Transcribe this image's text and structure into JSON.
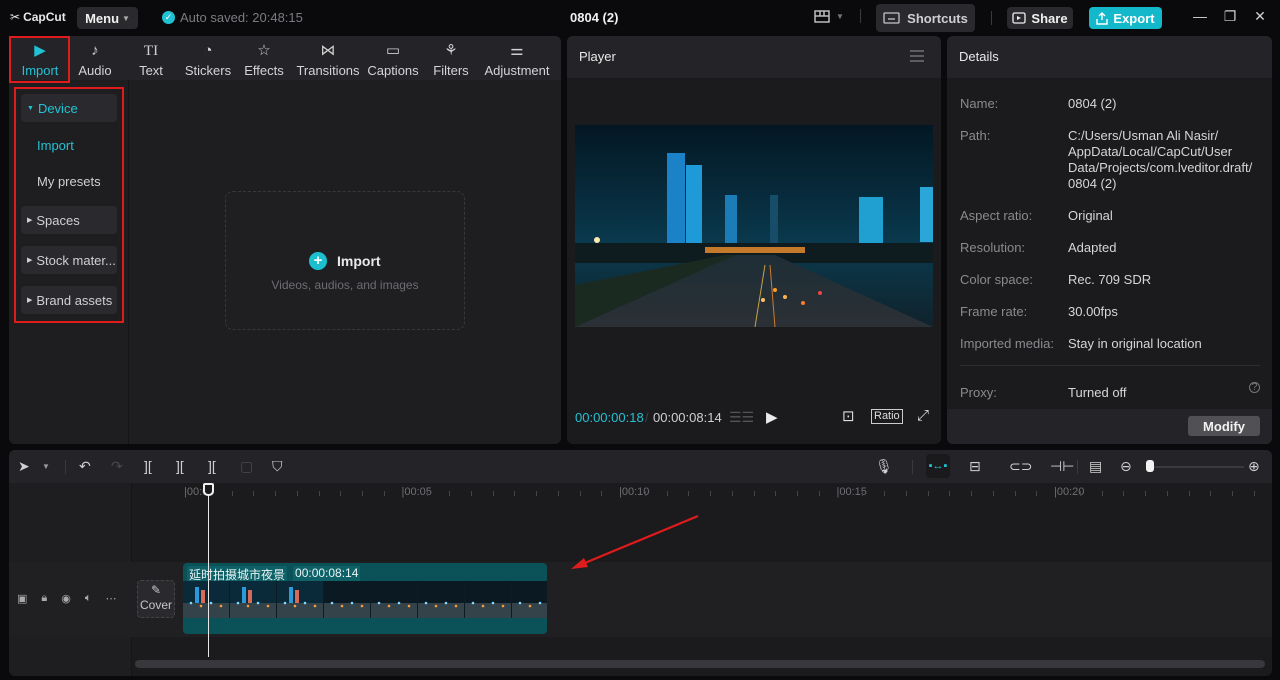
{
  "app": {
    "logo_text": "CapCut",
    "menu_label": "Menu",
    "autosave_text": "Auto saved: 20:48:15",
    "project_title": "0804 (2)",
    "shortcuts_label": "Shortcuts",
    "share_label": "Share",
    "export_label": "Export",
    "accent_color": "#13b8cb",
    "annotation_color": "#e01b1b"
  },
  "media_tabs": [
    {
      "label": "Import",
      "icon": "import-icon",
      "active": true
    },
    {
      "label": "Audio",
      "icon": "audio-icon"
    },
    {
      "label": "Text",
      "icon": "text-icon"
    },
    {
      "label": "Stickers",
      "icon": "stickers-icon"
    },
    {
      "label": "Effects",
      "icon": "effects-icon"
    },
    {
      "label": "Transitions",
      "icon": "transitions-icon"
    },
    {
      "label": "Captions",
      "icon": "captions-icon"
    },
    {
      "label": "Filters",
      "icon": "filters-icon"
    },
    {
      "label": "Adjustment",
      "icon": "adjustment-icon"
    }
  ],
  "sidebar": {
    "device": "Device",
    "import": "Import",
    "my_presets": "My presets",
    "spaces": "Spaces",
    "stock": "Stock mater...",
    "brand": "Brand assets"
  },
  "import_area": {
    "title": "Import",
    "subtitle": "Videos, audios, and images"
  },
  "player": {
    "title": "Player",
    "current_time": "00:00:00:18",
    "total_time": "00:00:08:14",
    "ratio_label": "Ratio"
  },
  "details": {
    "title": "Details",
    "rows": [
      {
        "label": "Name:",
        "value": "0804 (2)"
      },
      {
        "label": "Path:",
        "value": "C:/Users/Usman Ali Nasir/ AppData/Local/CapCut/User Data/Projects/com.lveditor.draft/ 0804 (2)"
      },
      {
        "label": "Aspect ratio:",
        "value": "Original"
      },
      {
        "label": "Resolution:",
        "value": "Adapted"
      },
      {
        "label": "Color space:",
        "value": "Rec. 709 SDR"
      },
      {
        "label": "Frame rate:",
        "value": "30.00fps"
      },
      {
        "label": "Imported media:",
        "value": "Stay in original location"
      },
      {
        "label": "Proxy:",
        "value": "Turned off"
      }
    ],
    "modify_label": "Modify"
  },
  "timeline": {
    "ruler_labels": [
      "00:00",
      "00:05",
      "00:10",
      "00:15",
      "00:20"
    ],
    "clip_name": "延时拍摄城市夜景",
    "clip_duration": "00:00:08:14",
    "cover_label": "Cover"
  }
}
